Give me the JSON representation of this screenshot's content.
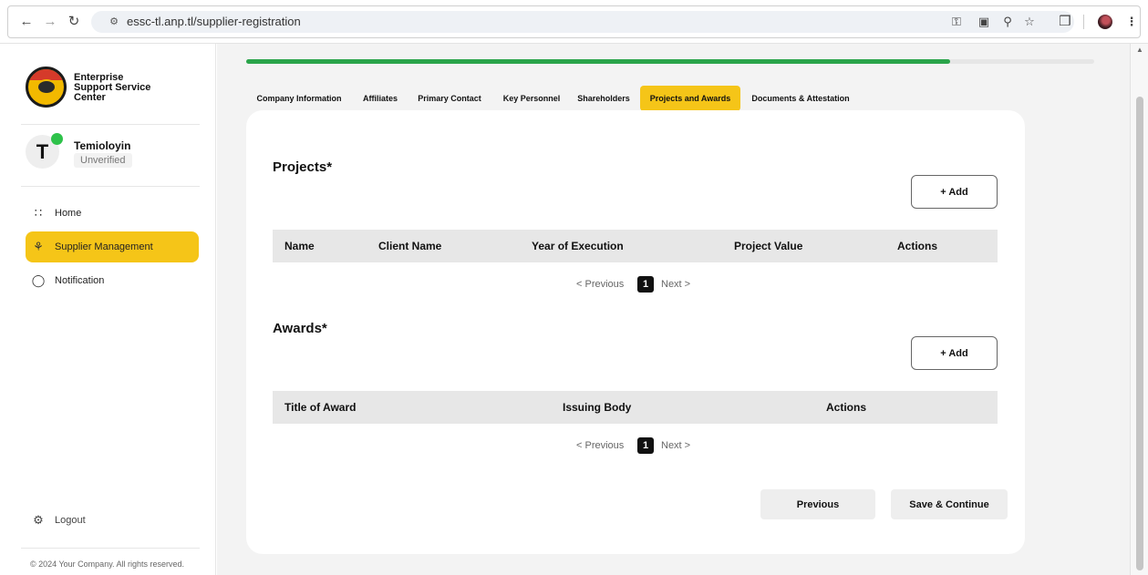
{
  "browser": {
    "url": "essc-tl.anp.tl/supplier-registration",
    "icons": {
      "back": "arrow-left-icon",
      "forward": "arrow-right-icon",
      "reload": "reload-icon",
      "site_info": "site-info-icon",
      "password": "password-key-icon",
      "cast": "cast-icon",
      "zoom": "zoom-icon",
      "bookmark": "star-icon",
      "extensions": "puzzle-icon",
      "menu": "kebab-menu-icon"
    }
  },
  "sidebar": {
    "brand_lines": [
      "Enterprise",
      "Support Service",
      "Center"
    ],
    "user": {
      "initial": "T",
      "name": "Temioloyin",
      "status": "Unverified"
    },
    "nav": [
      {
        "label": "Home",
        "icon": "grid-icon",
        "active": false
      },
      {
        "label": "Supplier Management",
        "icon": "org-chart-icon",
        "active": true
      },
      {
        "label": "Notification",
        "icon": "bell-icon",
        "active": false
      }
    ],
    "logout_label": "Logout",
    "copyright": "© 2024 Your Company. All rights reserved."
  },
  "progress": {
    "value_percent": 83
  },
  "tabs": [
    {
      "label": "Company Information",
      "active": false
    },
    {
      "label": "Affiliates",
      "active": false
    },
    {
      "label": "Primary Contact",
      "active": false
    },
    {
      "label": "Key Personnel",
      "active": false
    },
    {
      "label": "Shareholders",
      "active": false
    },
    {
      "label": "Projects and Awards",
      "active": true
    },
    {
      "label": "Documents & Attestation",
      "active": false
    }
  ],
  "projects": {
    "title": "Projects*",
    "add_label": "+ Add",
    "columns": [
      "Name",
      "Client Name",
      "Year of Execution",
      "Project Value",
      "Actions"
    ],
    "rows": []
  },
  "awards": {
    "title": "Awards*",
    "add_label": "+ Add",
    "columns": [
      "Title of Award",
      "Issuing Body",
      "Actions"
    ],
    "rows": []
  },
  "pagination": {
    "previous": "< Previous",
    "current": "1",
    "next": "Next >"
  },
  "footer": {
    "previous_label": "Previous",
    "save_label": "Save & Continue"
  },
  "colors": {
    "accent": "#f5c518",
    "progress": "#2aa44a",
    "online": "#2ec24a"
  }
}
